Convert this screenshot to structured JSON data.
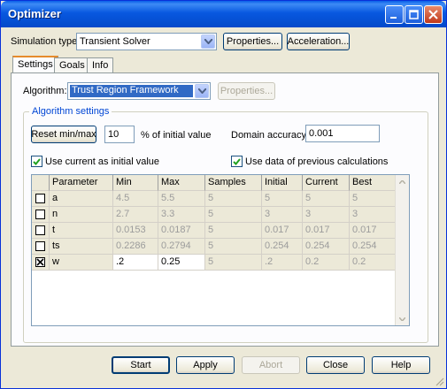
{
  "window": {
    "title": "Optimizer"
  },
  "simulation": {
    "label": "Simulation type:",
    "value": "Transient Solver",
    "properties_label": "Properties...",
    "acceleration_label": "Acceleration..."
  },
  "tabs": [
    {
      "label": "Settings",
      "active": true
    },
    {
      "label": "Goals",
      "active": false
    },
    {
      "label": "Info",
      "active": false
    }
  ],
  "algorithm": {
    "label": "Algorithm:",
    "value": "Trust Region Framework",
    "properties_label": "Properties..."
  },
  "algorithm_settings": {
    "title": "Algorithm settings",
    "reset_label": "Reset min/max",
    "percent_value": "10",
    "percent_label": "% of initial value",
    "domain_accuracy_label": "Domain accuracy:",
    "domain_accuracy_value": "0.001",
    "use_current_label": "Use current as initial value",
    "use_current_checked": true,
    "use_previous_label": "Use data of previous calculations",
    "use_previous_checked": true
  },
  "table": {
    "columns": [
      "Parameter",
      "Min",
      "Max",
      "Samples",
      "Initial",
      "Current",
      "Best"
    ],
    "rows": [
      {
        "checked": false,
        "cells": [
          "a",
          "4.5",
          "5.5",
          "5",
          "5",
          "5",
          "5"
        ]
      },
      {
        "checked": false,
        "cells": [
          "n",
          "2.7",
          "3.3",
          "5",
          "3",
          "3",
          "3"
        ]
      },
      {
        "checked": false,
        "cells": [
          "t",
          "0.0153",
          "0.0187",
          "5",
          "0.017",
          "0.017",
          "0.017"
        ]
      },
      {
        "checked": false,
        "cells": [
          "ts",
          "0.2286",
          "0.2794",
          "5",
          "0.254",
          "0.254",
          "0.254"
        ]
      },
      {
        "checked": true,
        "cells": [
          "w",
          ".2",
          "0.25",
          "5",
          ".2",
          "0.2",
          "0.2"
        ]
      }
    ]
  },
  "footer": {
    "start_label": "Start",
    "apply_label": "Apply",
    "abort_label": "Abort",
    "close_label": "Close",
    "help_label": "Help"
  },
  "colors": {
    "titlebar": "#0858e0",
    "window_bg": "#ece9d8",
    "selection": "#316ac5",
    "group_title": "#0046d5"
  }
}
